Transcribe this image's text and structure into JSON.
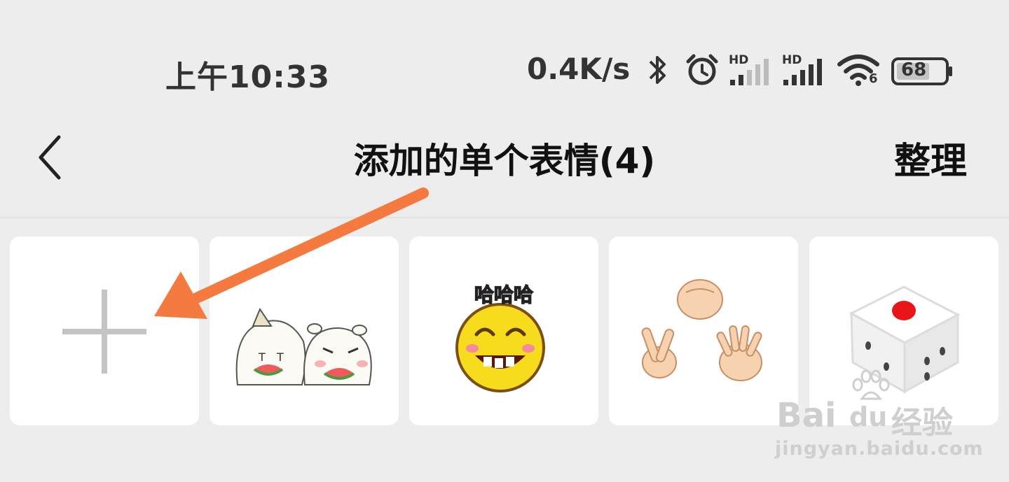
{
  "status_bar": {
    "time": "上午10:33",
    "network_speed": "0.4K/s",
    "signal_label_1": "HD",
    "signal_label_2": "HD",
    "wifi_badge": "6",
    "battery_level": "68",
    "icons": [
      "bluetooth-icon",
      "alarm-icon",
      "signal-icon",
      "signal-icon",
      "wifi-icon",
      "battery-icon"
    ]
  },
  "nav": {
    "back_icon": "chevron-left-icon",
    "title": "添加的单个表情(4)",
    "organize_label": "整理"
  },
  "sticker_grid": {
    "add_icon": "plus-icon",
    "items": [
      {
        "name": "add-tile"
      },
      {
        "name": "sticker-watermelon-friends"
      },
      {
        "name": "sticker-laughing-face",
        "caption": "哈哈哈"
      },
      {
        "name": "sticker-rock-paper-scissors"
      },
      {
        "name": "sticker-dice"
      }
    ]
  },
  "watermark": {
    "brand": "Bai",
    "brand_suffix": "du",
    "product": "经验",
    "url": "jingyan.baidu.com"
  },
  "colors": {
    "background": "#ededed",
    "tile": "#ffffff",
    "annotation_arrow": "#f47a3f",
    "dice_dot": "#e8161a",
    "smiley": "#f7dc1e"
  }
}
